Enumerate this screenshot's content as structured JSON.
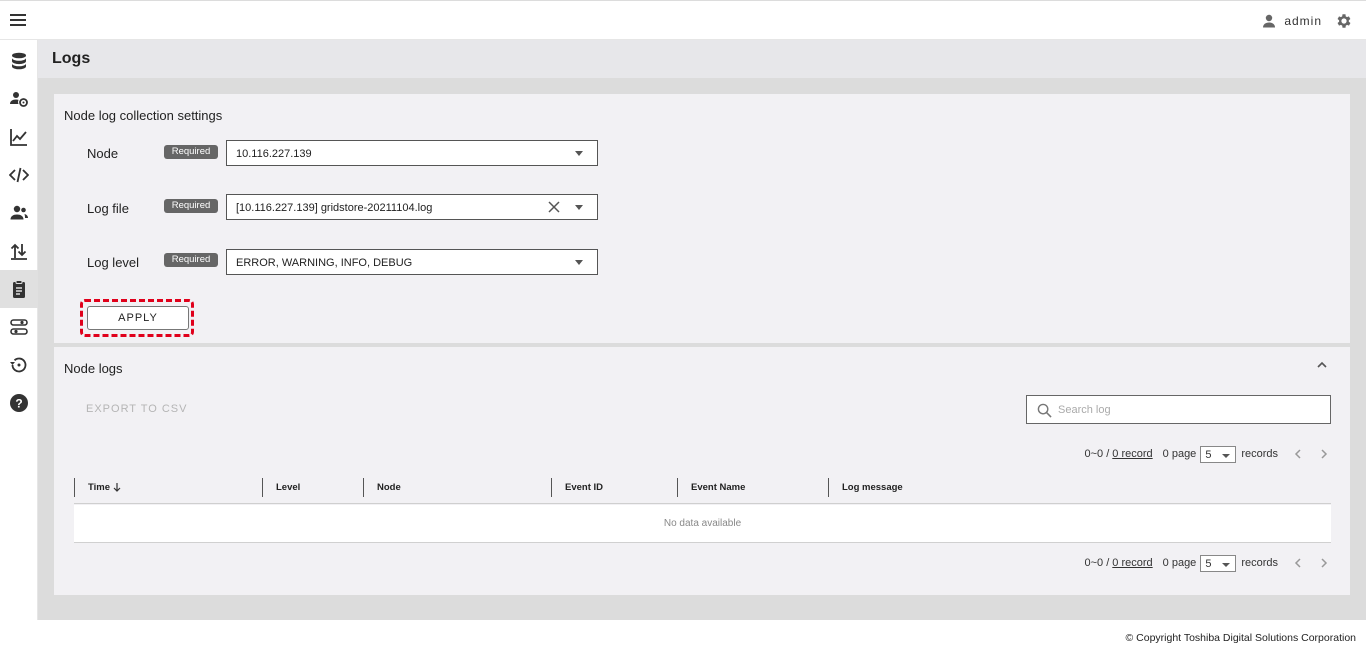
{
  "header": {
    "username": "admin"
  },
  "page": {
    "title": "Logs"
  },
  "settings": {
    "title": "Node log collection settings",
    "required_label": "Required",
    "node": {
      "label": "Node",
      "value": "10.116.227.139"
    },
    "log_file": {
      "label": "Log file",
      "value": "[10.116.227.139] gridstore-20211104.log"
    },
    "log_level": {
      "label": "Log level",
      "value": "ERROR, WARNING, INFO, DEBUG"
    },
    "apply_label": "APPLY"
  },
  "logs": {
    "title": "Node logs",
    "export_label": "EXPORT TO CSV",
    "search_placeholder": "Search log",
    "pager": {
      "range": "0~0 /",
      "record": "0 record",
      "page": "0 page",
      "per_page": "5",
      "records": "records"
    },
    "columns": [
      "Time",
      "Level",
      "Node",
      "Event ID",
      "Event Name",
      "Log message"
    ],
    "no_data": "No data available"
  },
  "footer": {
    "copyright": "© Copyright Toshiba Digital Solutions Corporation"
  },
  "colors": {
    "highlight": "#e0001b",
    "required_badge": "#666666",
    "card_bg": "#f2f1f4"
  }
}
